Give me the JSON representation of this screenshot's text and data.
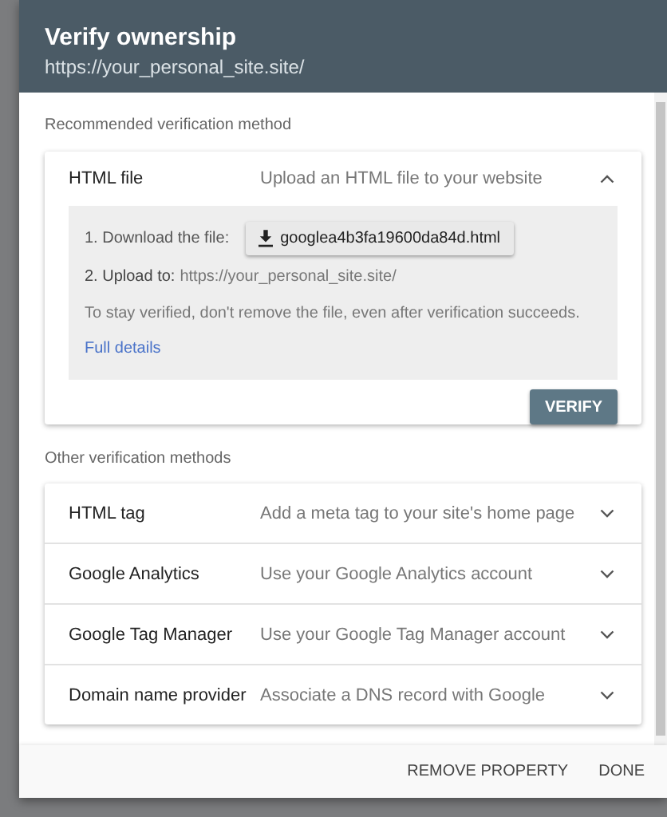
{
  "dialog": {
    "title": "Verify ownership",
    "subtitle": "https://your_personal_site.site/"
  },
  "recommended": {
    "heading": "Recommended verification method",
    "method": {
      "name": "HTML file",
      "description": "Upload an HTML file to your website",
      "expanded": true,
      "download_label": "1. Download the file:",
      "download_file": "googlea4b3fa19600da84d.html",
      "upload_label": "2. Upload to:",
      "upload_url": "https://your_personal_site.site/",
      "note": "To stay verified, don't remove the file, even after verification succeeds.",
      "link": "Full details",
      "verify_button": "VERIFY"
    }
  },
  "other": {
    "heading": "Other verification methods",
    "methods": [
      {
        "name": "HTML tag",
        "description": "Add a meta tag to your site's home page",
        "expanded": false
      },
      {
        "name": "Google Analytics",
        "description": "Use your Google Analytics account",
        "expanded": false
      },
      {
        "name": "Google Tag Manager",
        "description": "Use your Google Tag Manager account",
        "expanded": false
      },
      {
        "name": "Domain name provider",
        "description": "Associate a DNS record with Google",
        "expanded": false
      }
    ]
  },
  "footer": {
    "buttons": [
      "REMOVE PROPERTY",
      "DONE"
    ]
  }
}
